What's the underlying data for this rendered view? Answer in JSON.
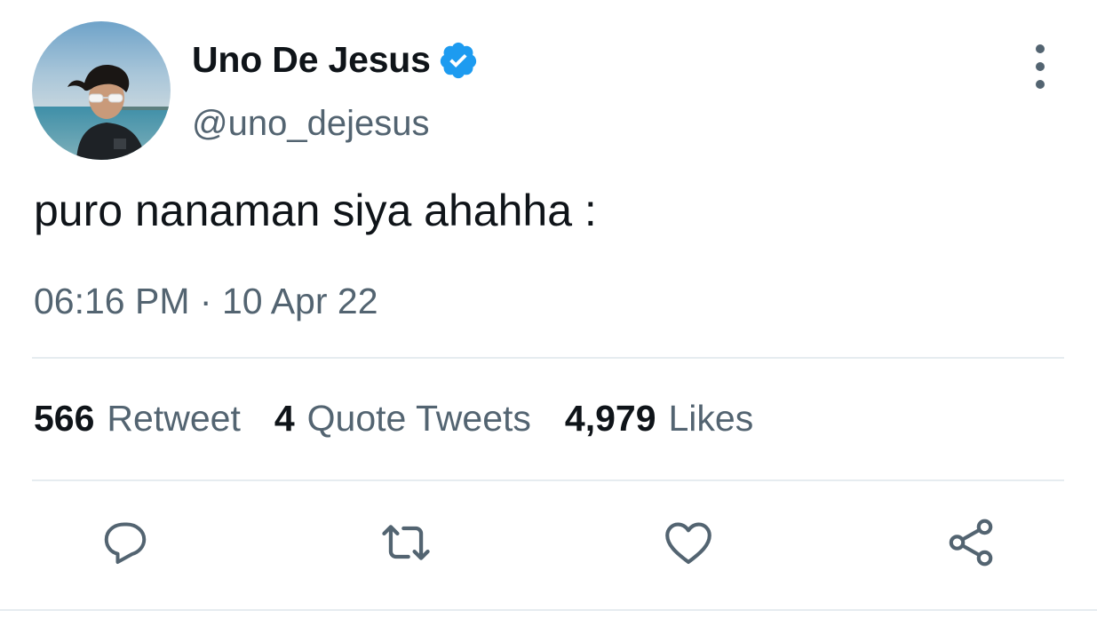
{
  "tweet": {
    "display_name": "Uno De Jesus",
    "handle": "@uno_dejesus",
    "verified": true,
    "text": "puro nanaman siya ahahha :",
    "time": "06:16 PM",
    "separator": "·",
    "date": "10 Apr 22"
  },
  "stats": {
    "retweets": {
      "count": "566",
      "label": "Retweet"
    },
    "quotes": {
      "count": "4",
      "label": "Quote Tweets"
    },
    "likes": {
      "count": "4,979",
      "label": "Likes"
    }
  },
  "actions": [
    {
      "name": "reply",
      "icon": "reply-icon"
    },
    {
      "name": "retweet",
      "icon": "retweet-icon"
    },
    {
      "name": "like",
      "icon": "heart-icon"
    },
    {
      "name": "share",
      "icon": "share-icon"
    }
  ],
  "colors": {
    "text_primary": "#0f1419",
    "text_secondary": "#536471",
    "verified_blue": "#1d9bf0",
    "divider": "#e6ecf0"
  }
}
